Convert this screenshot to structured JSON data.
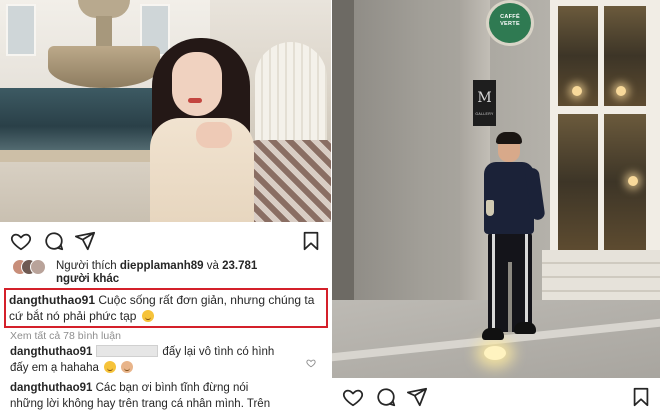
{
  "left_post": {
    "photo": {
      "subject": "woman-by-fountain",
      "colors": {
        "hair": "#241816",
        "top": "#f1e3d0",
        "pool": "#2a4048"
      }
    },
    "actions": {
      "icons": [
        "heart-icon",
        "comment-icon",
        "share-icon",
        "bookmark-icon"
      ]
    },
    "likes": {
      "prefix": "Người thích",
      "username": "diepplamanh89",
      "conjunction": "và",
      "count": "23.781",
      "others": "người khác"
    },
    "caption": {
      "username": "dangthuthao91",
      "line1": "Cuộc sống rất đơn giản, nhưng chúng ta",
      "line2": "cứ bắt nó phải phức tạp",
      "emoji": "smiling-face-emoji"
    },
    "view_all_comments": "Xem tất cả 78 bình luận",
    "comments": [
      {
        "username": "dangthuthao91",
        "text_after_mention": "đấy lại vô tình có hình",
        "line2": "đấy em ạ hahaha",
        "emoji": [
          "grinning-face-emoji",
          "see-no-evil-emoji"
        ]
      },
      {
        "username": "dangthuthao91",
        "text": "Các bạn ơi bình tĩnh đừng nói",
        "line2": "những lời không hay trên trang cá nhân mình. Trên"
      }
    ],
    "highlight_color": "#d4202a"
  },
  "right_post": {
    "photo": {
      "subject": "man-in-front-of-gallery",
      "sign_round_text": "CAFFÉ VERTE",
      "plaque_letter": "M",
      "plaque_caption": "GALLERY",
      "colors": {
        "sign": "#2f7a52",
        "wall": "#a29f98",
        "outfit": "#1b2238"
      }
    },
    "actions": {
      "icons": [
        "heart-icon",
        "comment-icon",
        "share-icon",
        "bookmark-icon"
      ]
    }
  }
}
